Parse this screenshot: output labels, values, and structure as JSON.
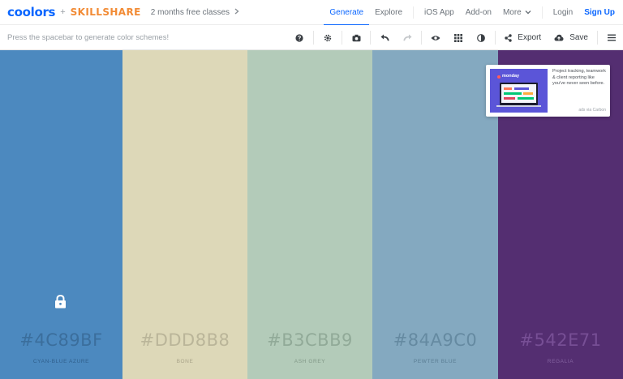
{
  "header": {
    "logo": "coolors",
    "plus": "+",
    "partner": "SKILLSHARE",
    "promo": "2 months free classes",
    "nav": [
      {
        "label": "Generate",
        "active": true
      },
      {
        "label": "Explore",
        "active": false
      },
      {
        "label": "iOS App",
        "active": false
      },
      {
        "label": "Add-on",
        "active": false
      },
      {
        "label": "More",
        "active": false
      },
      {
        "label": "Login",
        "active": false
      },
      {
        "label": "Sign Up",
        "active": false
      }
    ]
  },
  "toolbar": {
    "hint": "Press the spacebar to generate color schemes!",
    "export_label": "Export",
    "save_label": "Save",
    "icons": [
      "help-icon",
      "gear-icon",
      "camera-icon",
      "undo-icon",
      "redo-icon",
      "eye-icon",
      "grid-icon",
      "contrast-icon",
      "share-icon",
      "cloud-upload-icon",
      "menu-icon"
    ]
  },
  "palette": [
    {
      "hex": "#4C89BF",
      "name": "CYAN-BLUE AZURE",
      "color": "#4c89bf",
      "hex_color": "#3b6e9c",
      "name_color": "#2f5f8c",
      "locked": true
    },
    {
      "hex": "#DDD8B8",
      "name": "BONE",
      "color": "#ddd8b8",
      "hex_color": "#bab599",
      "name_color": "#a9a489",
      "locked": false
    },
    {
      "hex": "#B3CBB9",
      "name": "ASH GREY",
      "color": "#b3cbb9",
      "hex_color": "#91aa98",
      "name_color": "#819887",
      "locked": false
    },
    {
      "hex": "#84A9C0",
      "name": "PEWTER BLUE",
      "color": "#84a9c0",
      "hex_color": "#658aa1",
      "name_color": "#5a7d93",
      "locked": false
    },
    {
      "hex": "#542E71",
      "name": "REGALIA",
      "color": "#542e71",
      "hex_color": "#774f95",
      "name_color": "#8462a0",
      "locked": false
    }
  ],
  "ad": {
    "brand": "monday",
    "text": "Project tracking, teamwork & client reporting like you've never seen before.",
    "via": "ads via Carbon"
  }
}
